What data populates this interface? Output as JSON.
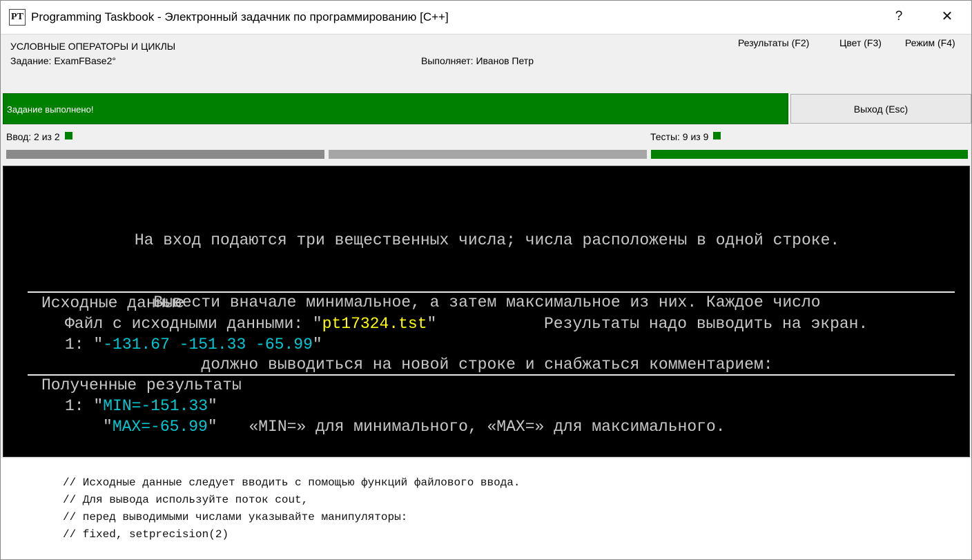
{
  "window": {
    "app_icon_text": "PT",
    "title": "Programming Taskbook - Электронный задачник по программированию [C++]",
    "help_glyph": "?",
    "close_glyph": "✕"
  },
  "header": {
    "topic": "УСЛОВНЫЕ ОПЕРАТОРЫ И ЦИКЛЫ",
    "task": "Задание: ExamFBase2°",
    "student": "Выполняет: Иванов Петр",
    "menu": {
      "results": "Результаты (F2)",
      "color": "Цвет (F3)",
      "mode": "Режим (F4)"
    }
  },
  "status": {
    "text": "Задание выполнено!",
    "exit_label": "Выход (Esc)"
  },
  "progress": {
    "input_label": "Ввод:  2 из 2",
    "tests_label": "Тесты:  9 из 9"
  },
  "console": {
    "description": [
      "На вход подаются три вещественных числа; числа расположены в одной строке.",
      "Вывести вначале минимальное, а затем максимальное из них. Каждое число",
      "должно выводиться на новой строке и снабжаться комментарием:",
      "«MIN=» для минимального, «MAX=» для максимального."
    ],
    "input_section": {
      "heading": "Исходные данные",
      "file_prefix": "Файл с исходными данными: \"",
      "file_name": "pt17324.tst",
      "file_suffix": "\"",
      "output_note": "Результаты надо выводить на экран.",
      "line_prefix": "1: \"",
      "line_value": "-131.67 -151.33 -65.99",
      "line_suffix": "\""
    },
    "output_section": {
      "heading": "Полученные результаты",
      "line1_prefix": "1: \"",
      "line1_value": "MIN=-151.33",
      "line1_suffix": "\"",
      "line2_prefix": "\"",
      "line2_value": "MAX=-65.99",
      "line2_suffix": "\""
    }
  },
  "comments": [
    "// Исходные данные следует вводить с помощью функций файлового ввода.",
    "// Для вывода используйте поток cout,",
    "// перед выводимыми числами указывайте манипуляторы:",
    "// fixed, setprecision(2)"
  ],
  "colors": {
    "success": "#008000",
    "console_bg": "#000000",
    "console_text": "#c8c8c8",
    "highlight_yellow": "#ffff00",
    "highlight_cyan": "#00c8d2"
  }
}
